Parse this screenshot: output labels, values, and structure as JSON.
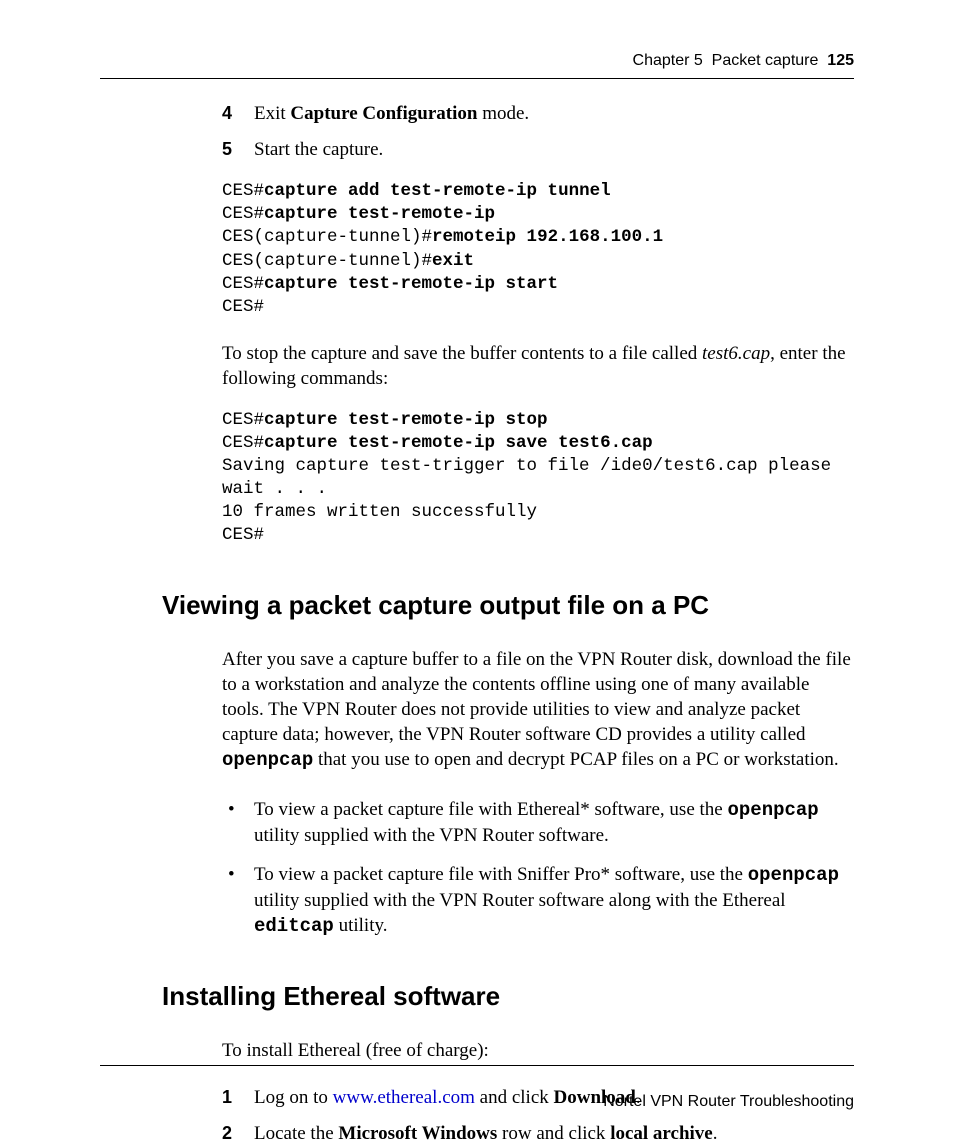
{
  "header": {
    "chapter": "Chapter 5",
    "title": "Packet capture",
    "page": "125"
  },
  "steps_a": [
    {
      "n": "4",
      "html": "Exit <b>Capture Configuration</b> mode."
    },
    {
      "n": "5",
      "html": "Start the capture."
    }
  ],
  "code_a_html": "CES#<b>capture add test-remote-ip tunnel</b>\nCES#<b>capture test-remote-ip</b>\nCES(capture-tunnel)#<b>remoteip 192.168.100.1</b>\nCES(capture-tunnel)#<b>exit</b>\nCES#<b>capture test-remote-ip start</b>\nCES#",
  "para_a_html": "To stop the capture and save the buffer contents to a file called <span class=\"italic\">test6.cap</span>, enter the following commands:",
  "code_b_html": "CES#<b>capture test-remote-ip stop</b>\nCES#<b>capture test-remote-ip save test6.cap</b>\nSaving capture test-trigger to file /ide0/test6.cap please wait . . .\n10 frames written successfully\nCES#",
  "h_viewing": "Viewing a packet capture output file on a PC",
  "para_b_html": "After you save a capture buffer to a file on the VPN Router disk, download the file to a workstation and analyze the contents offline using one of many available tools. The VPN Router does not provide utilities to view and analyze packet capture data; however, the VPN Router software CD provides a utility called <span class=\"mono-bold\">openpcap</span> that you use to open and decrypt PCAP files on a PC or workstation.",
  "bullets": [
    "To view a packet capture file with Ethereal* software, use the <span class=\"mono-bold\">openpcap</span> utility supplied with the VPN Router software.",
    "To view a packet capture file with Sniffer Pro* software, use the <span class=\"mono-bold\">openpcap</span> utility supplied with the VPN Router software along with the Ethereal <span class=\"mono-bold\">editcap</span> utility."
  ],
  "h_install": "Installing Ethereal software",
  "para_c": "To install Ethereal (free of charge):",
  "steps_b": [
    {
      "n": "1",
      "html": "Log on to <a class=\"link\" data-name=\"ethereal-link\" data-interactable=\"true\">www.ethereal.com</a> and click <b>Download</b>."
    },
    {
      "n": "2",
      "html": "Locate the <b>Microsoft Windows</b> row and click <b>local archive</b>."
    }
  ],
  "footer": "Nortel VPN Router Troubleshooting"
}
